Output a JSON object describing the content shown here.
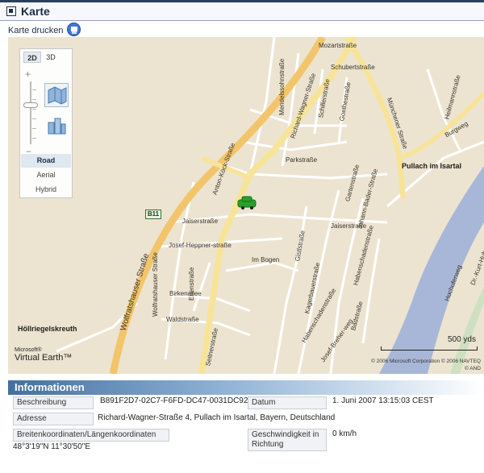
{
  "header": {
    "title": "Karte"
  },
  "print": {
    "label": "Karte drucken",
    "icon": "printer-icon"
  },
  "map": {
    "view_modes": [
      "2D",
      "3D"
    ],
    "active_view_mode": "2D",
    "map_types": [
      "Road",
      "Aerial",
      "Hybrid"
    ],
    "active_map_type": "Road",
    "scale": "500 yds",
    "copyright_line1": "© 2006 Microsoft Corporation  © 2006 NAVTEQ",
    "copyright_line2": "© AND",
    "logo_line1": "Microsoft®",
    "logo_line2": "Virtual Earth™",
    "road_badge": "B11",
    "colors": {
      "background": "#ece4d1",
      "major_road": "#f7e49a",
      "highway": "#f3c56b",
      "river": "#a8b7d8"
    },
    "labels": {
      "mozartstrasse": "Mozartstraße",
      "schubertstrasse": "Schubertstraße",
      "mendelssohnstrasse": "Mendelssohnstraße",
      "richard_wagner": "Richard-Wagner-Straße",
      "schillerstrasse": "Schillerstraße",
      "goethestrasse": "Goethestraße",
      "muenchener": "Münchener Straße",
      "heilmannstrasse": "Heilmannstraße",
      "burgweg": "Burgweg",
      "parkstrasse": "Parkstraße",
      "anton_koeck": "Anton-Köck-Straße",
      "pullach": "Pullach im Isartal",
      "jaiserstrasse1": "Jaiserstraße",
      "jaiserstrasse2": "Jaiserstraße",
      "gartenstrasse": "Gartenstraße",
      "johann_bader": "Johann-Bader-Straße",
      "josef_heppner": "Josef-Heppner-straße",
      "wolfratshauser": "Wolfratshauser Straße",
      "wolfratshauser_small": "Wolfratshauser Straße",
      "im_bogen": "Im Bogen",
      "gistlstrasse": "Gistlstraße",
      "kagerbauerstrasse": "Kagerbauerstraße",
      "habenschaden1": "Habenschadenstraße",
      "habenschaden2": "Habenschadenstraße",
      "erlenstrasse": "Erlenstraße",
      "birkenallee": "Birkenallee",
      "waldstrasse": "Waldstraße",
      "seitnerstrasse": "Seitnerstraße",
      "bahnstrasse": "Badstraße",
      "josef_breher": "Josef-Breher-weg",
      "hochufer": "Hochuferweg",
      "dr_kurt": "Dr.-Kurt-Huber",
      "hoellriegelskreuth": "Höllriegelskreuth"
    },
    "vehicle_icon": "car-icon"
  },
  "info": {
    "title": "Informationen",
    "beschreibung_label": "Beschreibung",
    "beschreibung_value": "B891F2D7-02C7-F6FD-DC47-0031DC92",
    "datum_label": "Datum",
    "datum_value": "1. Juni 2007 13:15:03 CEST",
    "adresse_label": "Adresse",
    "adresse_value": "Richard-Wagner-Straße 4, Pullach im Isartal, Bayern, Deutschland",
    "koord_label": "Breitenkoordinaten/Längenkoordinaten",
    "koord_value": "48°3'19\"N 11°30'50\"E",
    "speed_label": "Geschwindigkeit in Richtung",
    "speed_value": "0 km/h"
  }
}
